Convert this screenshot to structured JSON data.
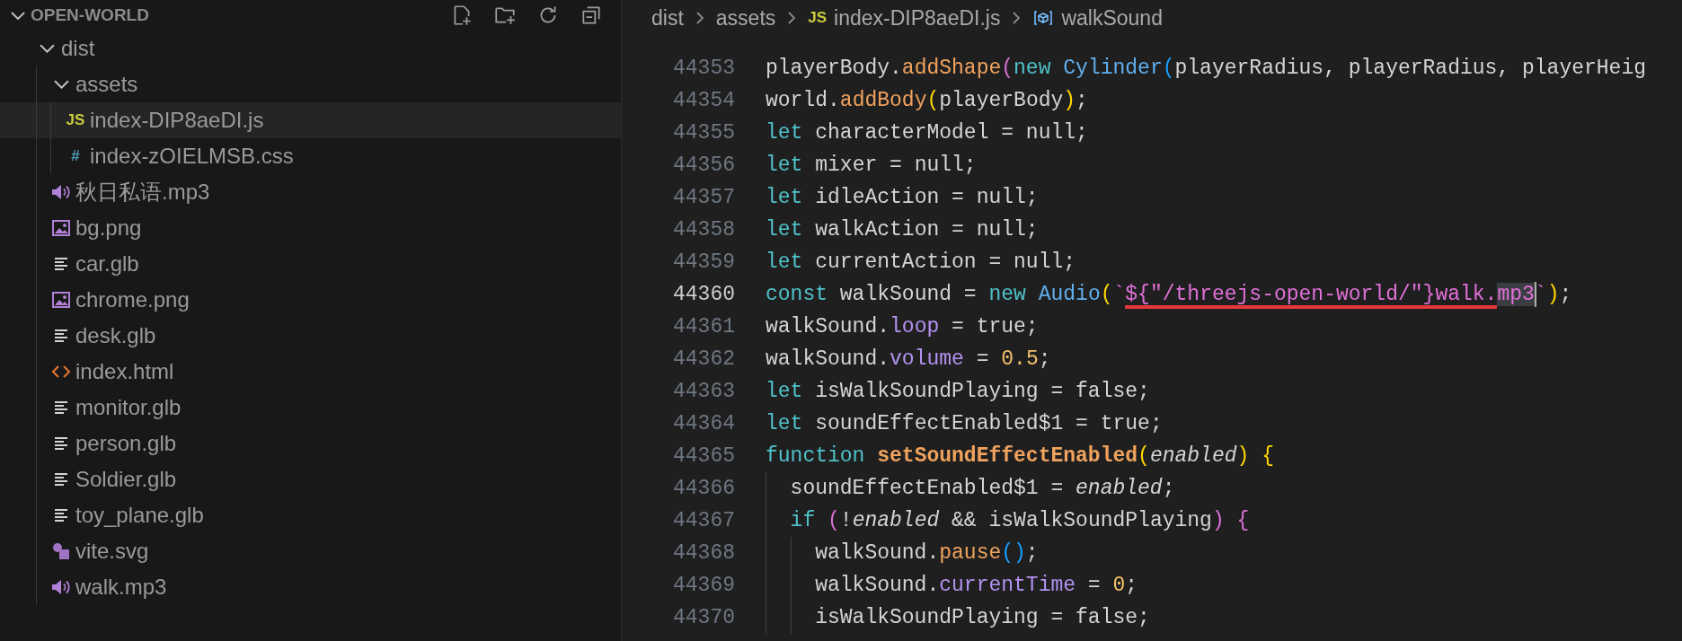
{
  "explorer": {
    "title": "OPEN-WORLD",
    "expanded": true,
    "tree": [
      {
        "name": "dist",
        "kind": "folder",
        "expanded": true,
        "selected": false,
        "children": [
          {
            "name": "assets",
            "kind": "folder",
            "expanded": true,
            "selected": false,
            "children": [
              {
                "name": "index-DIP8aeDI.js",
                "kind": "js",
                "icon_text": "JS",
                "selected": true
              },
              {
                "name": "index-zOIELMSB.css",
                "kind": "css",
                "icon_text": "#",
                "selected": false
              }
            ]
          },
          {
            "name": "秋日私语.mp3",
            "kind": "audio",
            "selected": false
          },
          {
            "name": "bg.png",
            "kind": "image",
            "selected": false
          },
          {
            "name": "car.glb",
            "kind": "model",
            "selected": false
          },
          {
            "name": "chrome.png",
            "kind": "image",
            "selected": false
          },
          {
            "name": "desk.glb",
            "kind": "model",
            "selected": false
          },
          {
            "name": "index.html",
            "kind": "html",
            "selected": false
          },
          {
            "name": "monitor.glb",
            "kind": "model",
            "selected": false
          },
          {
            "name": "person.glb",
            "kind": "model",
            "selected": false
          },
          {
            "name": "Soldier.glb",
            "kind": "model",
            "selected": false
          },
          {
            "name": "toy_plane.glb",
            "kind": "model",
            "selected": false
          },
          {
            "name": "vite.svg",
            "kind": "vite",
            "selected": false
          },
          {
            "name": "walk.mp3",
            "kind": "audio",
            "selected": false
          }
        ]
      }
    ]
  },
  "editor": {
    "breadcrumbs": [
      {
        "label": "dist",
        "kind": "folder"
      },
      {
        "label": "assets",
        "kind": "folder"
      },
      {
        "label": "index-DIP8aeDI.js",
        "kind": "file",
        "icon_text": "JS"
      },
      {
        "label": "walkSound",
        "kind": "symbol"
      }
    ],
    "lines": [
      {
        "number": "44353",
        "current": false,
        "tokens": [
          {
            "text": "playerBody.",
            "kind": "plain"
          },
          {
            "text": "addShape",
            "kind": "function"
          },
          {
            "text": "(",
            "kind": "bracket2"
          },
          {
            "text": "new ",
            "kind": "keyword"
          },
          {
            "text": "Cylinder",
            "kind": "class"
          },
          {
            "text": "(",
            "kind": "bracket3"
          },
          {
            "text": "playerRadius, playerRadius, playerHeig",
            "kind": "plain"
          }
        ]
      },
      {
        "number": "44354",
        "current": false,
        "tokens": [
          {
            "text": "world.",
            "kind": "plain"
          },
          {
            "text": "addBody",
            "kind": "function"
          },
          {
            "text": "(",
            "kind": "bracket1"
          },
          {
            "text": "playerBody",
            "kind": "plain"
          },
          {
            "text": ")",
            "kind": "bracket1"
          },
          {
            "text": ";",
            "kind": "plain"
          }
        ]
      },
      {
        "number": "44355",
        "current": false,
        "tokens": [
          {
            "text": "let",
            "kind": "keyword"
          },
          {
            "text": " characterModel = null;",
            "kind": "plain"
          }
        ]
      },
      {
        "number": "44356",
        "current": false,
        "tokens": [
          {
            "text": "let",
            "kind": "keyword"
          },
          {
            "text": " mixer = null;",
            "kind": "plain"
          }
        ]
      },
      {
        "number": "44357",
        "current": false,
        "tokens": [
          {
            "text": "let",
            "kind": "keyword"
          },
          {
            "text": " idleAction = null;",
            "kind": "plain"
          }
        ]
      },
      {
        "number": "44358",
        "current": false,
        "tokens": [
          {
            "text": "let",
            "kind": "keyword"
          },
          {
            "text": " walkAction = null;",
            "kind": "plain"
          }
        ]
      },
      {
        "number": "44359",
        "current": false,
        "tokens": [
          {
            "text": "let",
            "kind": "keyword"
          },
          {
            "text": " currentAction = null;",
            "kind": "plain"
          }
        ]
      },
      {
        "number": "44360",
        "current": true,
        "tokens": [
          {
            "text": "const",
            "kind": "keyword"
          },
          {
            "text": " walkSound = ",
            "kind": "plain"
          },
          {
            "text": "new ",
            "kind": "keyword"
          },
          {
            "text": "Audio",
            "kind": "class"
          },
          {
            "text": "(",
            "kind": "bracket1"
          },
          {
            "text": "`",
            "kind": "string"
          },
          {
            "text": "${",
            "kind": "string",
            "underlined": true
          },
          {
            "text": "\"/threejs-open-world/\"",
            "kind": "string",
            "underlined": true
          },
          {
            "text": "}",
            "kind": "string",
            "underlined": true
          },
          {
            "text": "walk.",
            "kind": "string",
            "underlined": true
          },
          {
            "text": "mp3",
            "kind": "string",
            "highlighted": true,
            "cursor": true
          },
          {
            "text": "`",
            "kind": "string"
          },
          {
            "text": ")",
            "kind": "bracket1"
          },
          {
            "text": ";",
            "kind": "plain"
          }
        ]
      },
      {
        "number": "44361",
        "current": false,
        "tokens": [
          {
            "text": "walkSound.",
            "kind": "plain"
          },
          {
            "text": "loop",
            "kind": "property"
          },
          {
            "text": " = true;",
            "kind": "plain"
          }
        ]
      },
      {
        "number": "44362",
        "current": false,
        "tokens": [
          {
            "text": "walkSound.",
            "kind": "plain"
          },
          {
            "text": "volume",
            "kind": "property"
          },
          {
            "text": " = ",
            "kind": "plain"
          },
          {
            "text": "0.5",
            "kind": "number"
          },
          {
            "text": ";",
            "kind": "plain"
          }
        ]
      },
      {
        "number": "44363",
        "current": false,
        "tokens": [
          {
            "text": "let",
            "kind": "keyword"
          },
          {
            "text": " isWalkSoundPlaying = false;",
            "kind": "plain"
          }
        ]
      },
      {
        "number": "44364",
        "current": false,
        "tokens": [
          {
            "text": "let",
            "kind": "keyword"
          },
          {
            "text": " soundEffectEnabled$1 = true;",
            "kind": "plain"
          }
        ]
      },
      {
        "number": "44365",
        "current": false,
        "tokens": [
          {
            "text": "function ",
            "kind": "keyword"
          },
          {
            "text": "setSoundEffectEnabled",
            "kind": "definition"
          },
          {
            "text": "(",
            "kind": "bracket1"
          },
          {
            "text": "enabled",
            "kind": "parameter"
          },
          {
            "text": ")",
            "kind": "bracket1"
          },
          {
            "text": " {",
            "kind": "bracket1"
          }
        ],
        "children": [
          {
            "number": "44366",
            "current": false,
            "tokens": [
              {
                "text": "soundEffectEnabled$1 = ",
                "kind": "plain"
              },
              {
                "text": "enabled",
                "kind": "parameter"
              },
              {
                "text": ";",
                "kind": "plain"
              }
            ]
          },
          {
            "number": "44367",
            "current": false,
            "tokens": [
              {
                "text": "if ",
                "kind": "keyword"
              },
              {
                "text": "(",
                "kind": "bracket2"
              },
              {
                "text": "!",
                "kind": "plain"
              },
              {
                "text": "enabled",
                "kind": "parameter"
              },
              {
                "text": " && isWalkSoundPlaying",
                "kind": "plain"
              },
              {
                "text": ")",
                "kind": "bracket2"
              },
              {
                "text": " {",
                "kind": "bracket2"
              }
            ],
            "children": [
              {
                "number": "44368",
                "current": false,
                "tokens": [
                  {
                    "text": "walkSound.",
                    "kind": "plain"
                  },
                  {
                    "text": "pause",
                    "kind": "function"
                  },
                  {
                    "text": "()",
                    "kind": "bracket3"
                  },
                  {
                    "text": ";",
                    "kind": "plain"
                  }
                ]
              },
              {
                "number": "44369",
                "current": false,
                "tokens": [
                  {
                    "text": "walkSound.",
                    "kind": "plain"
                  },
                  {
                    "text": "currentTime",
                    "kind": "property"
                  },
                  {
                    "text": " = ",
                    "kind": "plain"
                  },
                  {
                    "text": "0",
                    "kind": "number"
                  },
                  {
                    "text": ";",
                    "kind": "plain"
                  }
                ]
              },
              {
                "number": "44370",
                "current": false,
                "tokens": [
                  {
                    "text": "isWalkSoundPlaying = false;",
                    "kind": "plain"
                  }
                ]
              }
            ]
          }
        ]
      }
    ]
  }
}
